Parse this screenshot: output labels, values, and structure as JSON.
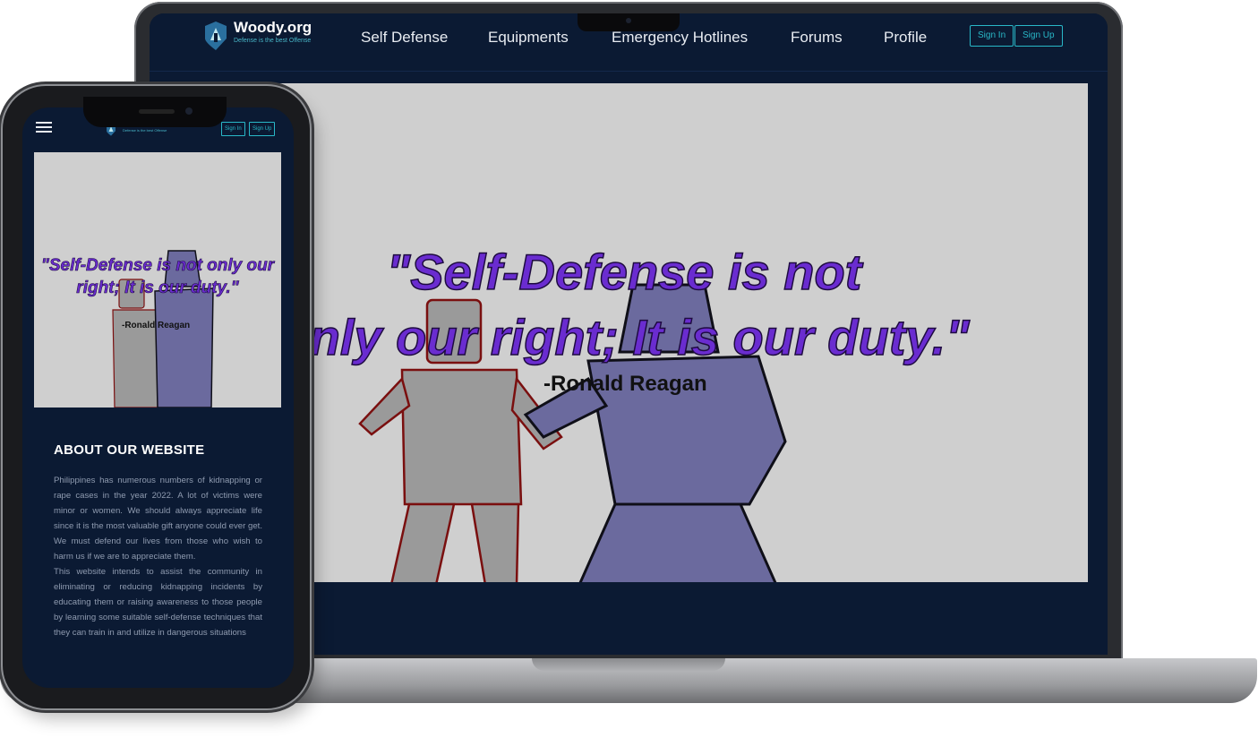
{
  "site": {
    "brand": "Woody.org",
    "tagline": "Defense is the best Offense",
    "nav": [
      "Self Defense",
      "Equipments",
      "Emergency Hotlines",
      "Forums",
      "Profile"
    ],
    "sign_in": "Sign In",
    "sign_up": "Sign Up"
  },
  "hero": {
    "quote_line1": "\"Self-Defense is not",
    "quote_line2": "only our right; It is our duty.\"",
    "author": "-Ronald Reagan"
  },
  "mobile": {
    "tagline": "Defense is the best Offense",
    "sign_in": "Sign In",
    "sign_up": "Sign Up",
    "quote": "\"Self-Defense is not only our right; It is our duty.\"",
    "author": "-Ronald Reagan",
    "about_title": "ABOUT OUR WEBSITE",
    "about_p1": "Philippines has numerous numbers of kidnapping or rape cases in the year 2022. A lot of victims were minor or women. We should always appreciate life since it is the most valuable gift anyone could ever get. We must defend our lives from those who wish to harm us if we are to appreciate them.",
    "about_p2": "This website intends to assist the community in eliminating or reducing kidnapping incidents by educating them or raising awareness to those people by learning some suitable self-defense techniques that they can train in and utilize in dangerous situations"
  },
  "colors": {
    "nav_bg": "#0b1a33",
    "accent": "#29b8c8",
    "quote": "#6a2cd0",
    "hero_bg": "#cfcfcf"
  }
}
